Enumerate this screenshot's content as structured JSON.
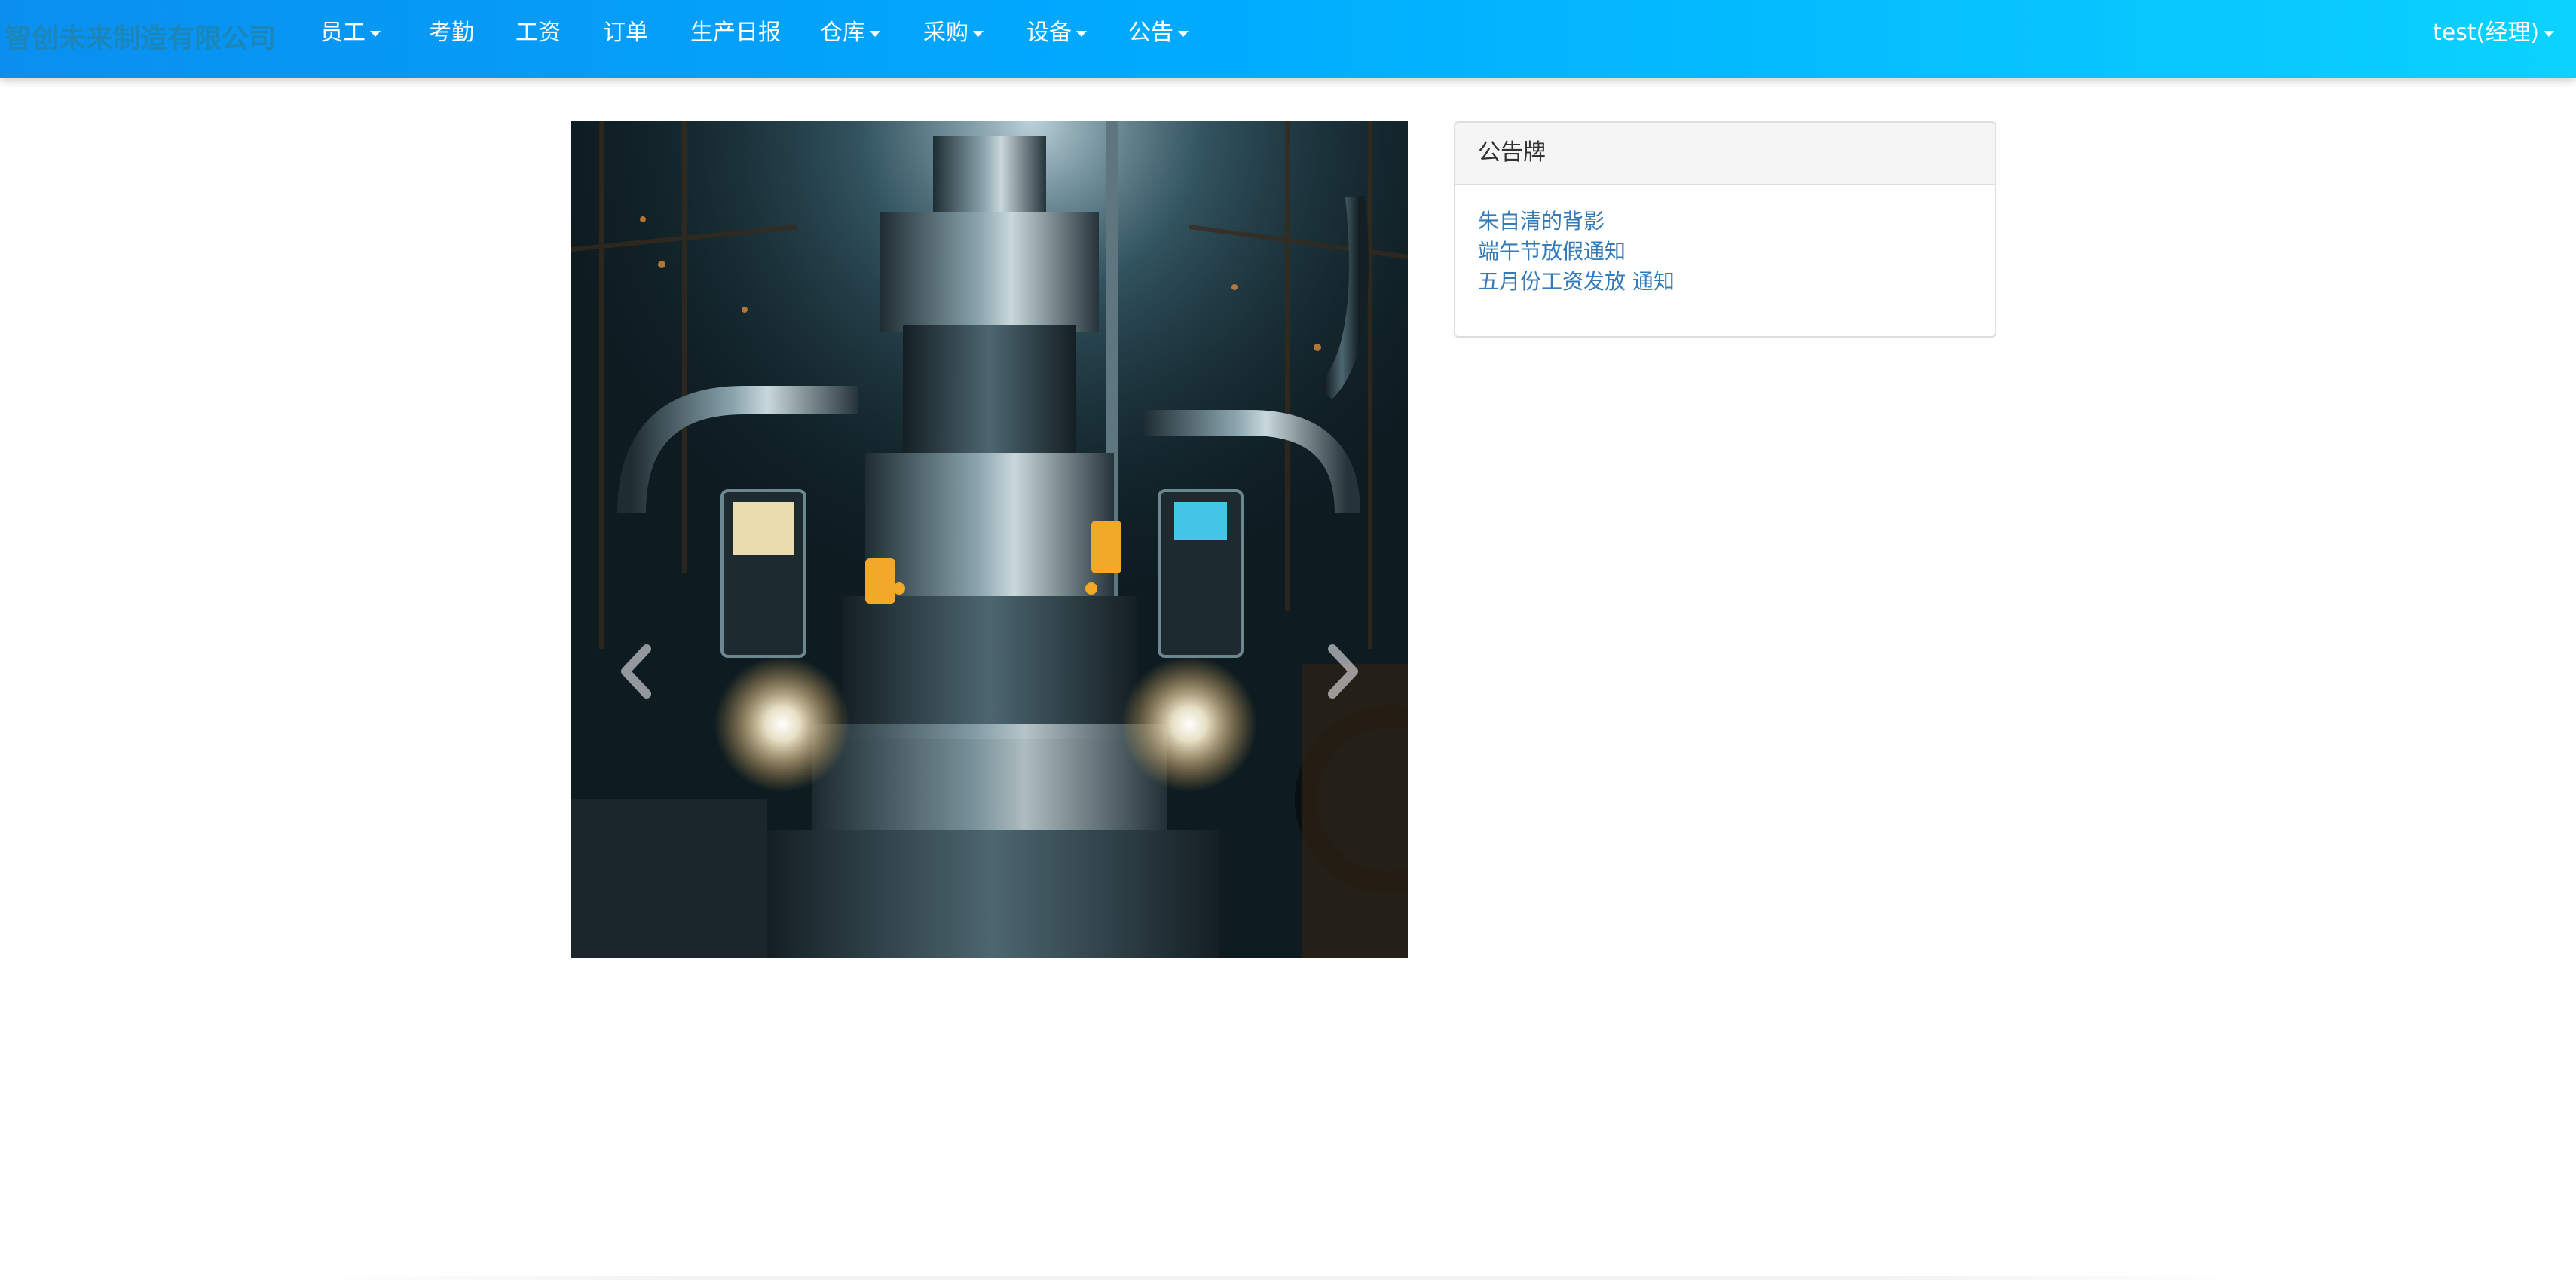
{
  "navbar": {
    "brand": "智创未来制造有限公司",
    "items": [
      {
        "label": "员工",
        "has_dropdown": true
      },
      {
        "label": "考勤",
        "has_dropdown": false
      },
      {
        "label": "工资",
        "has_dropdown": false
      },
      {
        "label": "订单",
        "has_dropdown": false
      },
      {
        "label": "生产日报",
        "has_dropdown": false
      },
      {
        "label": "仓库",
        "has_dropdown": true
      },
      {
        "label": "采购",
        "has_dropdown": true
      },
      {
        "label": "设备",
        "has_dropdown": true
      },
      {
        "label": "公告",
        "has_dropdown": true
      }
    ],
    "user": {
      "label": "test(经理)",
      "has_dropdown": true
    }
  },
  "carousel": {
    "slide_count": 5,
    "active_index": 0,
    "prev_icon": "chevron-left-icon",
    "next_icon": "chevron-right-icon"
  },
  "notice_board": {
    "title": "公告牌",
    "items": [
      {
        "label": "朱自清的背影"
      },
      {
        "label": "端午节放假通知"
      },
      {
        "label": "五月份工资发放 通知"
      }
    ]
  },
  "colors": {
    "navbar_start": "#0a8ff0",
    "navbar_end": "#0bd2ff",
    "brand_text": "#1b86b7",
    "link": "#337ab7",
    "panel_heading_bg": "#f5f5f5"
  }
}
